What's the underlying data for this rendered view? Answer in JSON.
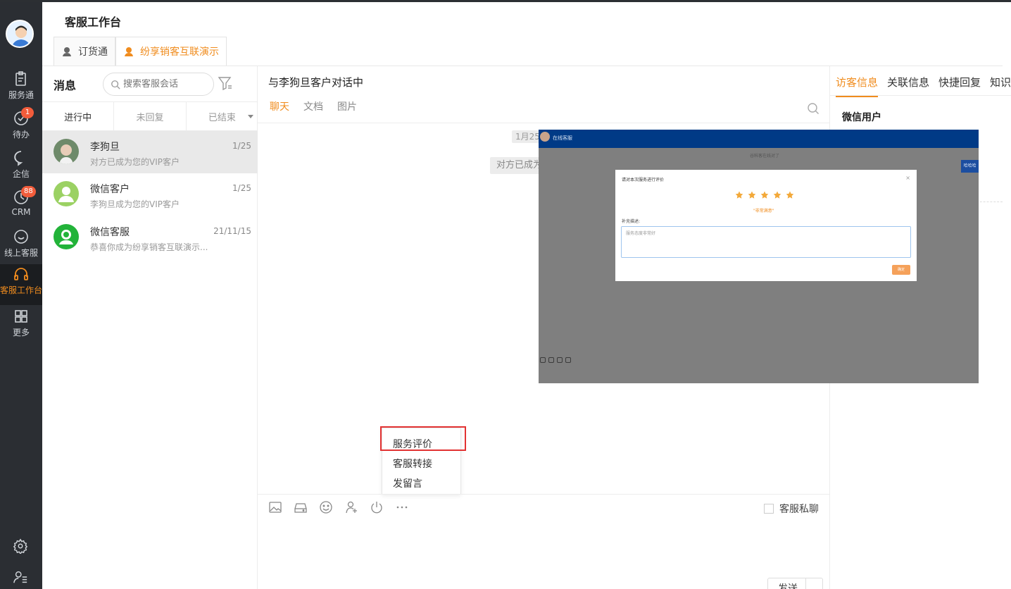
{
  "header": {
    "title": "客服工作台",
    "tabs": [
      {
        "label": "订货通",
        "active": false
      },
      {
        "label": "纷享销客互联演示",
        "active": true
      }
    ]
  },
  "nav": {
    "items": [
      {
        "label": "服务通",
        "icon": "clipboard-icon",
        "badge": ""
      },
      {
        "label": "待办",
        "icon": "check-circle-icon",
        "badge": "1"
      },
      {
        "label": "企信",
        "icon": "chat-bubble-icon",
        "badge": ""
      },
      {
        "label": "CRM",
        "icon": "crm-clock-icon",
        "badge": "88"
      },
      {
        "label": "线上客服",
        "icon": "online-service-icon",
        "badge": ""
      },
      {
        "label": "客服工作台",
        "icon": "headset-icon",
        "badge": "",
        "active": true
      },
      {
        "label": "更多",
        "icon": "grid-icon",
        "badge": ""
      }
    ],
    "bottom": [
      "settings-icon",
      "user-list-icon"
    ]
  },
  "messages": {
    "title": "消息",
    "search_placeholder": "搜索客服会话",
    "filters": [
      "进行中",
      "未回复",
      "已结束"
    ],
    "conversations": [
      {
        "name": "李狗旦",
        "time": "1/25",
        "last": "对方已成为您的VIP客户",
        "selected": true
      },
      {
        "name": "微信客户",
        "time": "1/25",
        "last": "李狗旦成为您的VIP客户"
      },
      {
        "name": "微信客服",
        "time": "21/11/15",
        "last": "恭喜你成为纷享销客互联演示..."
      }
    ]
  },
  "chat": {
    "title": "与李狗旦客户对话中",
    "tabs": [
      "聊天",
      "文档",
      "图片"
    ],
    "date": "1月25",
    "system_msg": "对方已成为",
    "menu": [
      "服务评价",
      "客服转接",
      "发留言"
    ],
    "private_label": "客服私聊",
    "send_label": "发送"
  },
  "right": {
    "tabs": [
      "访客信息",
      "关联信息",
      "快捷回复",
      "知识库"
    ],
    "user_type": "微信用户"
  },
  "overlay": {
    "bar_title": "在线客服",
    "tip": "谷科客在线对了",
    "blue_btn": "哈哈哈",
    "dialog_title": "请对本次服务进行评价",
    "rating": 5,
    "rating_text": "\"非常满意\"",
    "extra_label": "补充描述:",
    "extra_value": "服务态度非常好",
    "confirm": "确定"
  },
  "colors": {
    "accent": "#f08c1e",
    "nav_bg": "#2b2e33",
    "badge": "#f25c3b",
    "highlight": "#e23232",
    "overlay_bar": "#003a86"
  }
}
